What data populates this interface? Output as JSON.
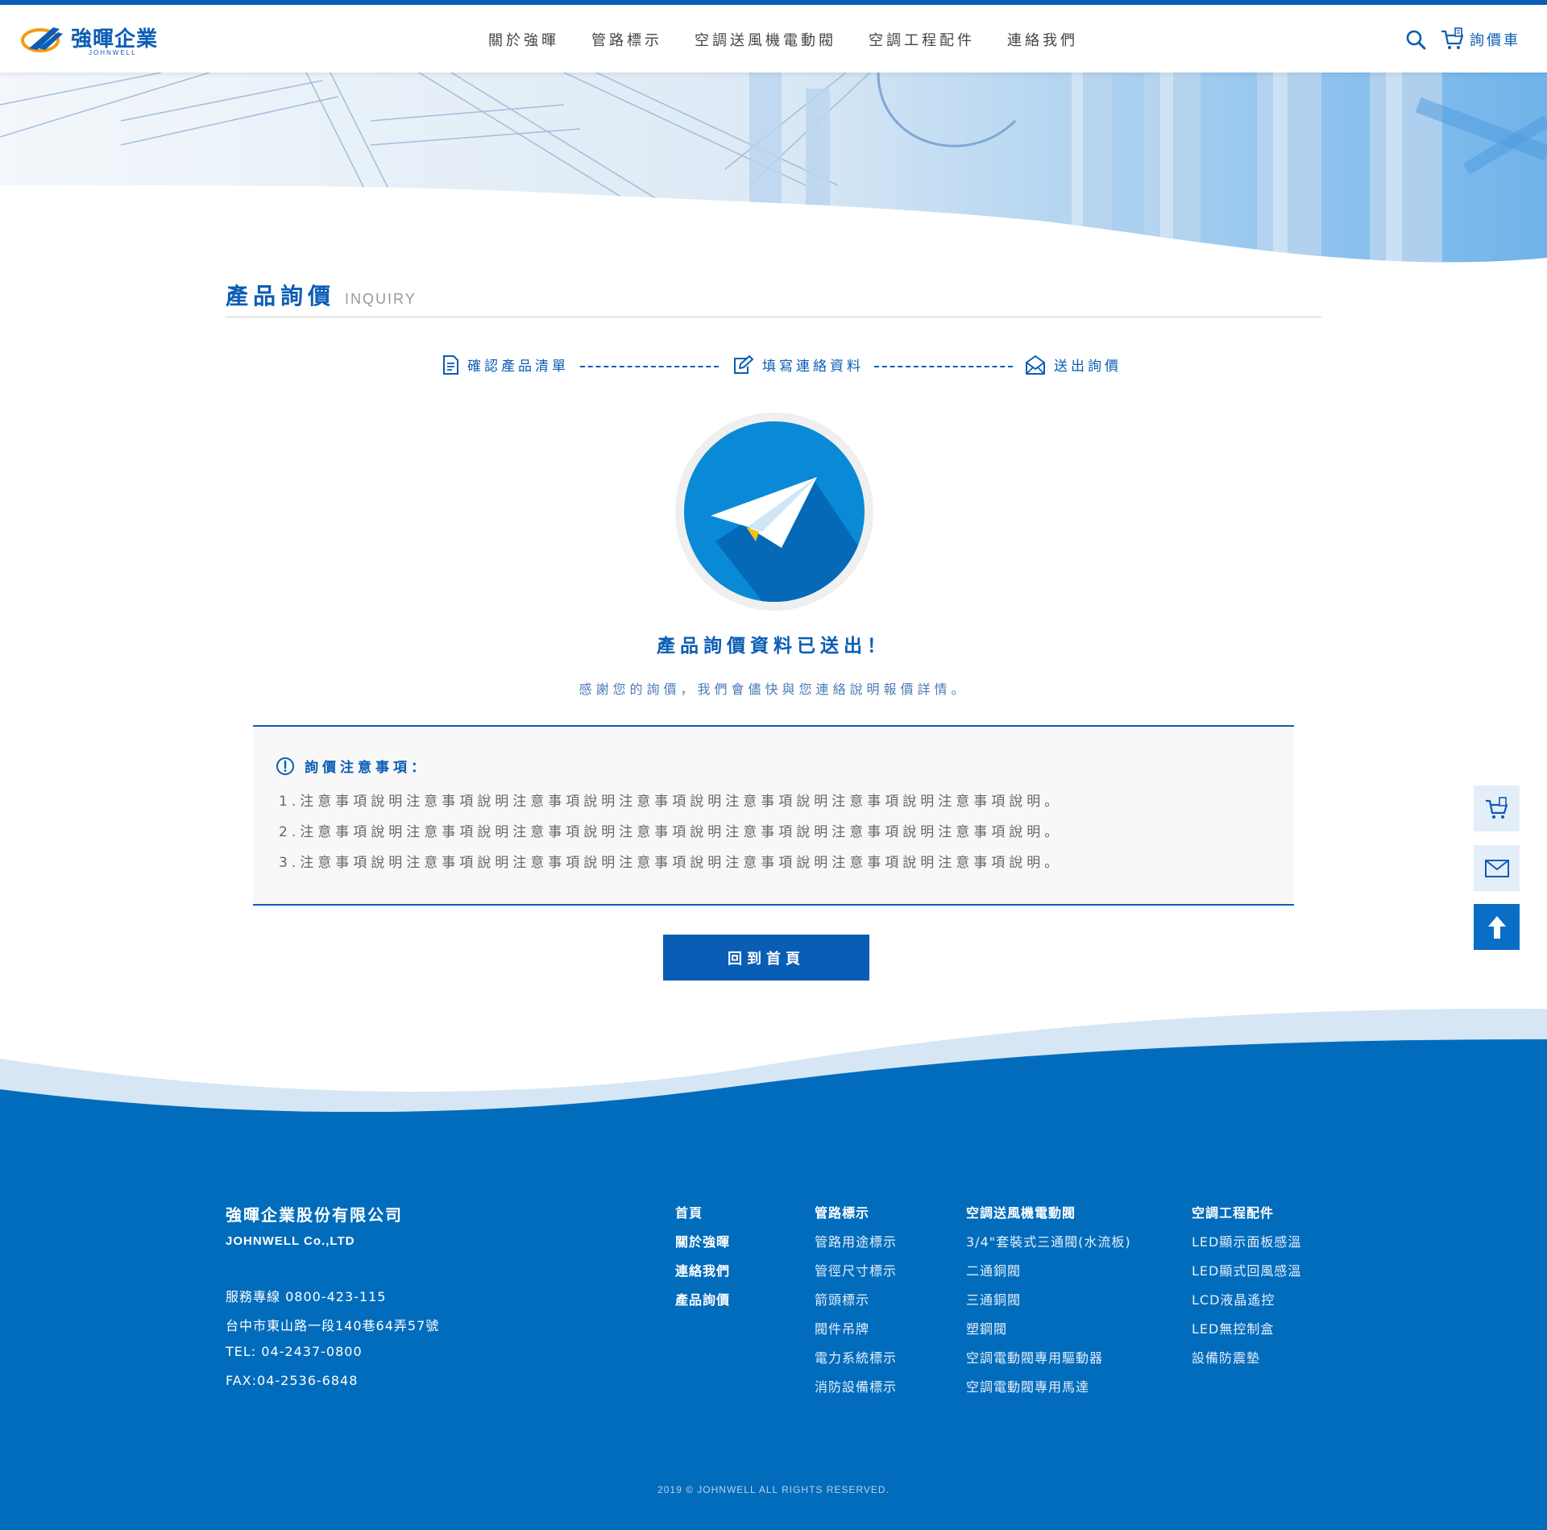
{
  "header": {
    "logo_cn": "強暉企業",
    "logo_en": "JOHNWELL",
    "nav": [
      "關於強暉",
      "管路標示",
      "空調送風機電動閥",
      "空調工程配件",
      "連絡我們"
    ],
    "cart_label": "詢價車"
  },
  "page": {
    "title_cn": "產品詢價",
    "title_en": "INQUIRY"
  },
  "steps": [
    "確認產品清單",
    "填寫連絡資料",
    "送出詢價"
  ],
  "success": {
    "title": "產品詢價資料已送出！",
    "subtitle": "感謝您的詢價，我們會儘快與您連絡說明報價詳情。"
  },
  "notice": {
    "title": "詢價注意事項：",
    "items": [
      "1.注意事項說明注意事項說明注意事項說明注意事項說明注意事項說明注意事項說明注意事項說明。",
      "2.注意事項說明注意事項說明注意事項說明注意事項說明注意事項說明注意事項說明注意事項說明。",
      "3.注意事項說明注意事項說明注意事項說明注意事項說明注意事項說明注意事項說明注意事項說明。"
    ]
  },
  "home_button": "回到首頁",
  "footer": {
    "company": "強暉企業股份有限公司",
    "company_en": "JOHNWELL Co.,LTD",
    "info": [
      "服務專線 0800-423-115",
      "台中市東山路一段140巷64弄57號",
      "TEL: 04-2437-0800",
      "FAX:04-2536-6848"
    ],
    "col1": [
      "首頁",
      "關於強暉",
      "連絡我們",
      "產品詢價"
    ],
    "col2": {
      "head": "管路標示",
      "items": [
        "管路用途標示",
        "管徑尺寸標示",
        "箭頭標示",
        "閥件吊牌",
        "電力系統標示",
        "消防設備標示"
      ]
    },
    "col3": {
      "head": "空調送風機電動閥",
      "items": [
        "3/4\"套裝式三通閥(水流板)",
        "二通銅閥",
        "三通銅閥",
        "塑鋼閥",
        "空調電動閥專用驅動器",
        "空調電動閥專用馬達"
      ]
    },
    "col4": {
      "head": "空調工程配件",
      "items": [
        "LED顯示面板感溫",
        "LED顯式回風感溫",
        "LCD液晶遙控",
        "LED無控制盒",
        "設備防震墊"
      ]
    },
    "copyright": "2019 © JOHNWELL ALL RIGHTS RESERVED."
  },
  "colors": {
    "brand": "#0a5db5",
    "footer": "#026cbc",
    "notice_bg": "#f8f8f8"
  },
  "icons": [
    "search-icon",
    "cart-icon",
    "document-icon",
    "edit-icon",
    "mail-icon",
    "paper-plane-icon",
    "info-icon",
    "arrow-up-icon"
  ]
}
